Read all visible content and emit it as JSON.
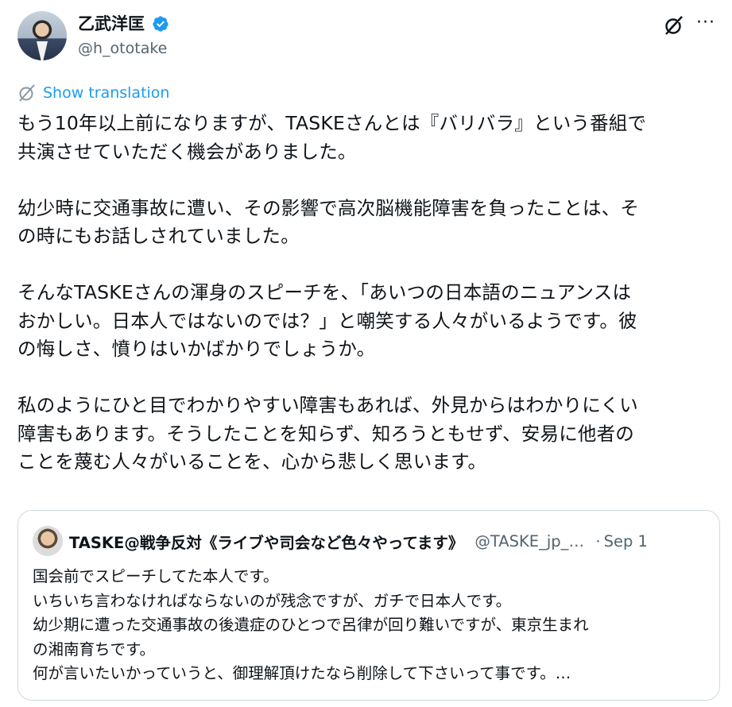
{
  "author": {
    "display_name": "乙武洋匡",
    "handle": "@h_ototake",
    "avatar_icon": "profile-photo"
  },
  "actions": {
    "grok_icon": "grok-icon",
    "more_label": "···"
  },
  "translate": {
    "label": "Show translation",
    "icon": "grok-icon"
  },
  "post": {
    "text": "もう10年以上前になりますが、TASKEさんとは『バリバラ』という番組で\n共演させていただく機会がありました。\n\n幼少時に交通事故に遭い、その影響で高次脳機能障害を負ったことは、そ\nの時にもお話しされていました。\n\nそんなTASKEさんの渾身のスピーチを、「あいつの日本語のニュアンスは\nおかしい。日本人ではないのでは？」と嘲笑する人々がいるようです。彼\nの悔しさ、憤りはいかばかりでしょうか。\n\n私のようにひと目でわかりやすい障害もあれば、外見からはわかりにくい\n障害もあります。そうしたことを知らず、知ろうともせず、安易に他者の\nことを蔑む人々がいることを、心から悲しく思います。"
  },
  "quote": {
    "display_name": "TASKE@戦争反対《ライブや司会など色々やってます》",
    "handle": "@TASKE_jp_official",
    "separator": "·",
    "date": "Sep 1",
    "text": "国会前でスピーチしてた本人です。\nいちいち言わなければならないのが残念ですが、ガチで日本人です。\n幼少期に遭った交通事故の後遺症のひとつで呂律が回り難いですが、東京生まれ\nの湘南育ちです。\n何が言いたいかっていうと、御理解頂けたなら削除して下さいって事です。…"
  },
  "colors": {
    "text": "#0f1419",
    "secondary": "#536471",
    "link": "#1d9bf0",
    "border": "#cfd9de",
    "verified": "#1d9bf0"
  }
}
